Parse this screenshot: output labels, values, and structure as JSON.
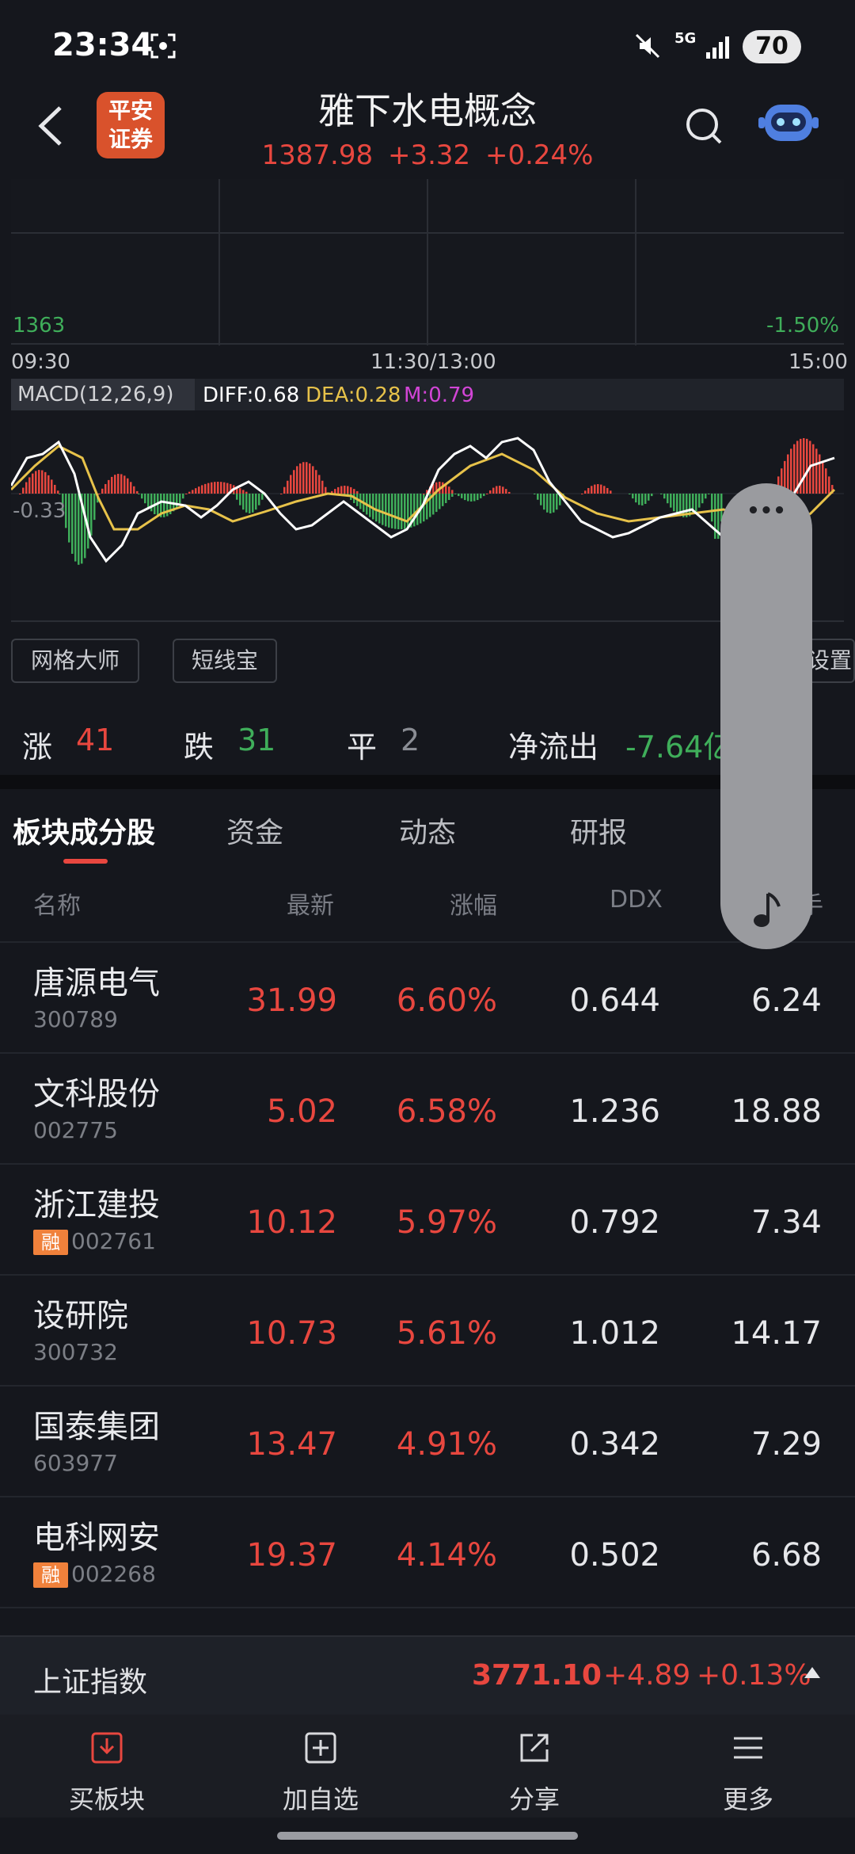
{
  "status_bar": {
    "time": "23:34",
    "network": "5G",
    "battery": "70"
  },
  "header": {
    "title": "雅下水电概念",
    "price": "1387.98",
    "change": "+3.32",
    "change_pct": "+0.24%",
    "brand_line1": "平安",
    "brand_line2": "证券"
  },
  "chart": {
    "low_label": "1363",
    "low_pct": "-1.50%",
    "time_start": "09:30",
    "time_mid": "11:30/13:00",
    "time_end": "15:00",
    "macd_label": "MACD(12,26,9)",
    "diff": "DIFF:0.68",
    "dea": "DEA:0.28",
    "m": "M:0.79",
    "macd_low": "-0.33",
    "settings_label": "设置",
    "colors": {
      "diff": "#ffffff",
      "dea": "#e7c24a",
      "m": "#d245d6",
      "up": "#e8473f",
      "down": "#3fae5a"
    }
  },
  "tools": {
    "grid_master": "网格大师",
    "short_treasure": "短线宝"
  },
  "stats": {
    "up_label": "涨",
    "up_count": "41",
    "down_label": "跌",
    "down_count": "31",
    "flat_label": "平",
    "flat_count": "2",
    "netflow_label": "净流出",
    "netflow_value": "-7.64亿"
  },
  "tabs": [
    "板块成分股",
    "资金",
    "动态",
    "研报"
  ],
  "table": {
    "headers": {
      "name": "名称",
      "latest": "最新",
      "change": "涨幅",
      "ddx": "DDX",
      "last_partial": "手"
    },
    "rows": [
      {
        "name": "唐源电气",
        "code": "300789",
        "margin": "",
        "latest": "31.99",
        "change": "6.60%",
        "ddx": "0.644",
        "extra": "6.24"
      },
      {
        "name": "文科股份",
        "code": "002775",
        "margin": "",
        "latest": "5.02",
        "change": "6.58%",
        "ddx": "1.236",
        "extra": "18.88"
      },
      {
        "name": "浙江建投",
        "code": "002761",
        "margin": "融",
        "latest": "10.12",
        "change": "5.97%",
        "ddx": "0.792",
        "extra": "7.34"
      },
      {
        "name": "设研院",
        "code": "300732",
        "margin": "",
        "latest": "10.73",
        "change": "5.61%",
        "ddx": "1.012",
        "extra": "14.17"
      },
      {
        "name": "国泰集团",
        "code": "603977",
        "margin": "",
        "latest": "13.47",
        "change": "4.91%",
        "ddx": "0.342",
        "extra": "7.29"
      },
      {
        "name": "电科网安",
        "code": "002268",
        "margin": "融",
        "latest": "19.37",
        "change": "4.14%",
        "ddx": "0.502",
        "extra": "6.68"
      }
    ]
  },
  "ticker": {
    "name": "上证指数",
    "value": "3771.10",
    "change": "+4.89",
    "change_pct": "+0.13%"
  },
  "bottom_nav": {
    "buy": "买板块",
    "add": "加自选",
    "share": "分享",
    "more": "更多"
  },
  "floating": {
    "menu": "•••"
  }
}
